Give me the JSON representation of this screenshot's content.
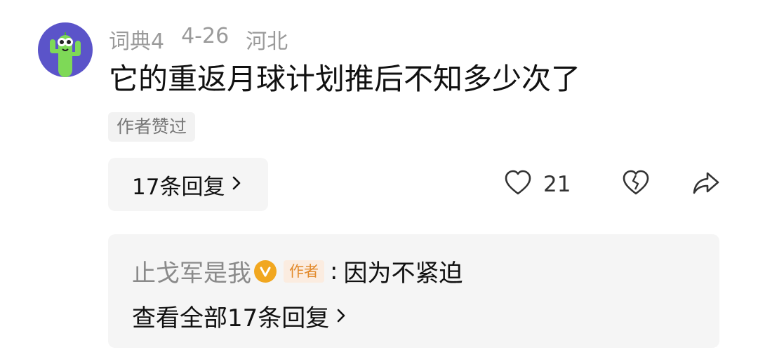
{
  "comment": {
    "avatar_icon": "cactus-avatar-icon",
    "username": "词典4",
    "date": "4-26",
    "location": "河北",
    "text": "它的重返月球计划推后不知多少次了",
    "author_liked_label": "作者赞过",
    "replies_label": "17条回复",
    "likes_count": "21"
  },
  "reply_preview": {
    "username": "止戈军是我",
    "verified_icon": "verified-v-icon",
    "author_tag": "作者",
    "separator": ":",
    "text": "因为不紧迫",
    "view_all_label": "查看全部17条回复"
  },
  "colors": {
    "avatar_bg": "#5b54c9",
    "cactus": "#7ed957",
    "badge": "#f1a720",
    "author_tag_text": "#e2892a",
    "author_tag_bg": "#fbece0"
  }
}
